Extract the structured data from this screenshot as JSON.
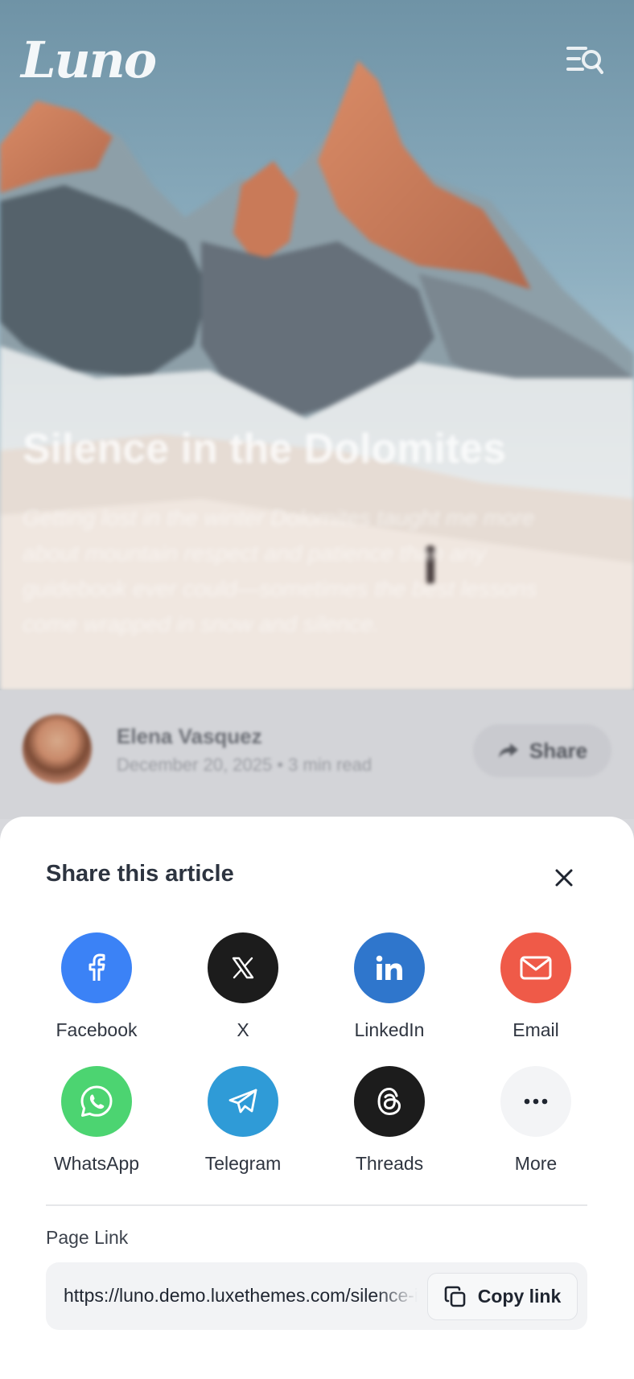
{
  "header": {
    "logo_text": "Luno",
    "menu_icon": "menu-search-icon"
  },
  "hero": {
    "title": "Silence in the Dolomites",
    "excerpt": "Getting lost in the winter Dolomites taught me more about mountain respect and patience than any guidebook ever could—sometimes the best lessons come wrapped in snow and silence."
  },
  "author": {
    "name": "Elena Vasquez",
    "meta": "December 20, 2025 • 3 min read",
    "share_label": "Share"
  },
  "share_sheet": {
    "title": "Share this article",
    "options": [
      {
        "label": "Facebook",
        "icon": "facebook-icon",
        "color": "#3b82f6"
      },
      {
        "label": "X",
        "icon": "x-icon",
        "color": "#1c1c1c"
      },
      {
        "label": "LinkedIn",
        "icon": "linkedin-icon",
        "color": "#2f76cc"
      },
      {
        "label": "Email",
        "icon": "mail-icon",
        "color": "#ef5a48"
      },
      {
        "label": "WhatsApp",
        "icon": "whatsapp-icon",
        "color": "#4cd471"
      },
      {
        "label": "Telegram",
        "icon": "telegram-icon",
        "color": "#2f9bd7"
      },
      {
        "label": "Threads",
        "icon": "threads-icon",
        "color": "#1c1c1c"
      },
      {
        "label": "More",
        "icon": "more-icon",
        "color": "#f3f4f6"
      }
    ],
    "page_link_label": "Page Link",
    "page_link_url": "https://luno.demo.luxethemes.com/silence-in-the-dolomites/",
    "copy_label": "Copy link"
  }
}
